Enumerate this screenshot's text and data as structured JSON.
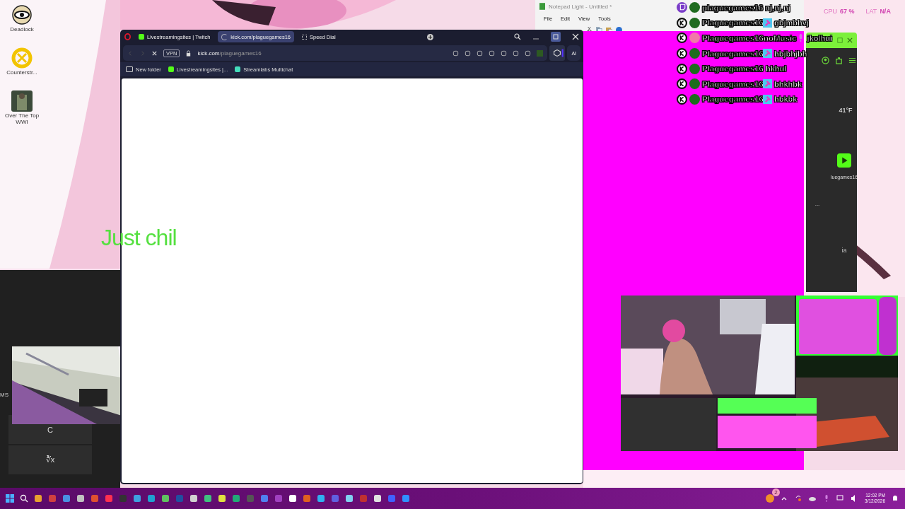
{
  "desktop_icons": [
    {
      "label": "Deadlock",
      "kind": "eye"
    },
    {
      "label": "Counterstr...",
      "kind": "target"
    },
    {
      "label": "Over The Top WWI",
      "kind": "poster"
    }
  ],
  "browser": {
    "tabs": [
      {
        "label": "Livestreamingsites | Twitch",
        "selected": false,
        "loading": false
      },
      {
        "label": "kick.com/plaguegames16",
        "selected": true,
        "loading": true
      },
      {
        "label": "Speed Dial",
        "selected": false,
        "loading": false
      }
    ],
    "vpn": "VPN",
    "url_domain": "kick.com",
    "url_path": "/plaguegames16",
    "ai": "AI",
    "bookmarks": [
      {
        "label": "New folder",
        "kind": "folder"
      },
      {
        "label": "Livestreamingsites |...",
        "kind": "site"
      },
      {
        "label": "Streamlabs Multichat",
        "kind": "chat"
      }
    ]
  },
  "overlay_text": "Just chil",
  "calculator": {
    "memory": "MS",
    "keys": [
      "C",
      "∛x"
    ]
  },
  "notepad": {
    "title": "Notepad Light - Untitled *",
    "menu": [
      "File",
      "Edit",
      "View",
      "Tools"
    ]
  },
  "chat": [
    {
      "kind": "twitch",
      "user": "plaguegames16",
      "message": "nj,nj,nj",
      "color": "#1e6b1e"
    },
    {
      "kind": "kick",
      "user": "Plaguegames16",
      "badge": {
        "kind": "hammer"
      },
      "message": "gbjmbhvj",
      "color": "#1e6b1e"
    },
    {
      "kind": "kick",
      "user": "Plaguegames16noMusic",
      "badge": {
        "kind": "mic"
      },
      "message": "jkolhui",
      "color": "#f07aa8"
    },
    {
      "kind": "kick",
      "user": "Plaguegames16",
      "badge": {
        "kind": "hammer"
      },
      "message": "hbjbhjbh",
      "color": "#1e6b1e"
    },
    {
      "kind": "kick",
      "user": "Plaguegames16",
      "message": "hkhul",
      "color": "#1e6b1e"
    },
    {
      "kind": "kick",
      "user": "Plaguegames16",
      "badge": {
        "kind": "hammer"
      },
      "message": "bhkhbk",
      "color": "#1e6b1e"
    },
    {
      "kind": "kick",
      "user": "Plaguegames16",
      "badge": {
        "kind": "hammer"
      },
      "message": "hbkbk",
      "color": "#1e6b1e"
    }
  ],
  "stats": {
    "cpu_label": "CPU",
    "cpu": "67 %",
    "lat_label": "LAT",
    "lat": "N/A"
  },
  "widget": {
    "temperature": "41°F",
    "channel": "luegames16",
    "more": "...",
    "note": "ia"
  },
  "taskbar": {
    "notification_count": "2",
    "time": "12:02 PM",
    "date": "3/12/2026"
  }
}
